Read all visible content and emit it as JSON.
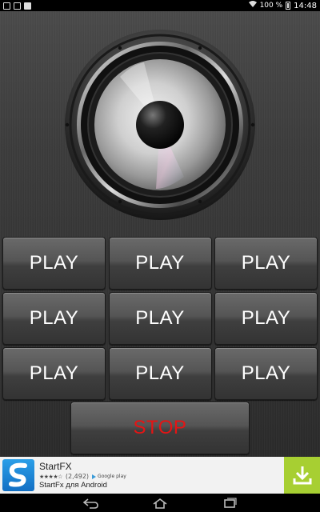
{
  "status_bar": {
    "battery": "100 %",
    "time": "14:48"
  },
  "buttons": {
    "play_label": "PLAY",
    "rows": [
      [
        "PLAY",
        "PLAY",
        "PLAY"
      ],
      [
        "PLAY",
        "PLAY",
        "PLAY"
      ],
      [
        "PLAY",
        "PLAY",
        "PLAY"
      ]
    ],
    "stop_label": "STOP"
  },
  "colors": {
    "stop_text": "#e51414",
    "ad_download_bg": "#a7cf32"
  },
  "ad": {
    "title": "StartFX",
    "rating_stars": "★★★★☆",
    "review_count": "(2,492)",
    "store_label": "Google play",
    "subtitle": "StartFx для Android"
  },
  "icons": {
    "status_left": [
      "notification-square-icon",
      "notification-square-icon",
      "shopping-bag-icon"
    ],
    "status_right": [
      "wifi-icon",
      "battery-icon"
    ],
    "ad": [
      "app-icon",
      "download-icon"
    ],
    "nav": [
      "back-icon",
      "home-icon",
      "recent-apps-icon"
    ]
  }
}
